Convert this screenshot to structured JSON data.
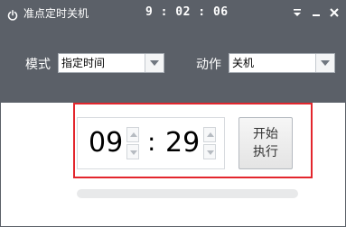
{
  "window": {
    "title": "准点定时关机",
    "clock": "9 : 02 : 06",
    "buttons": [
      "menu-icon",
      "minimize-icon",
      "close-icon"
    ]
  },
  "mode": {
    "label": "模式",
    "selected": "指定时间"
  },
  "action": {
    "label": "动作",
    "selected": "关机"
  },
  "timer": {
    "hour": "09",
    "separator": ":",
    "minute": "29"
  },
  "start_button": {
    "line1": "开始",
    "line2": "执行"
  },
  "progress": {
    "fraction": 0
  },
  "colors": {
    "chrome": "#5b6068",
    "highlight": "#e3262d",
    "progress_track": "#e8e9ea"
  }
}
